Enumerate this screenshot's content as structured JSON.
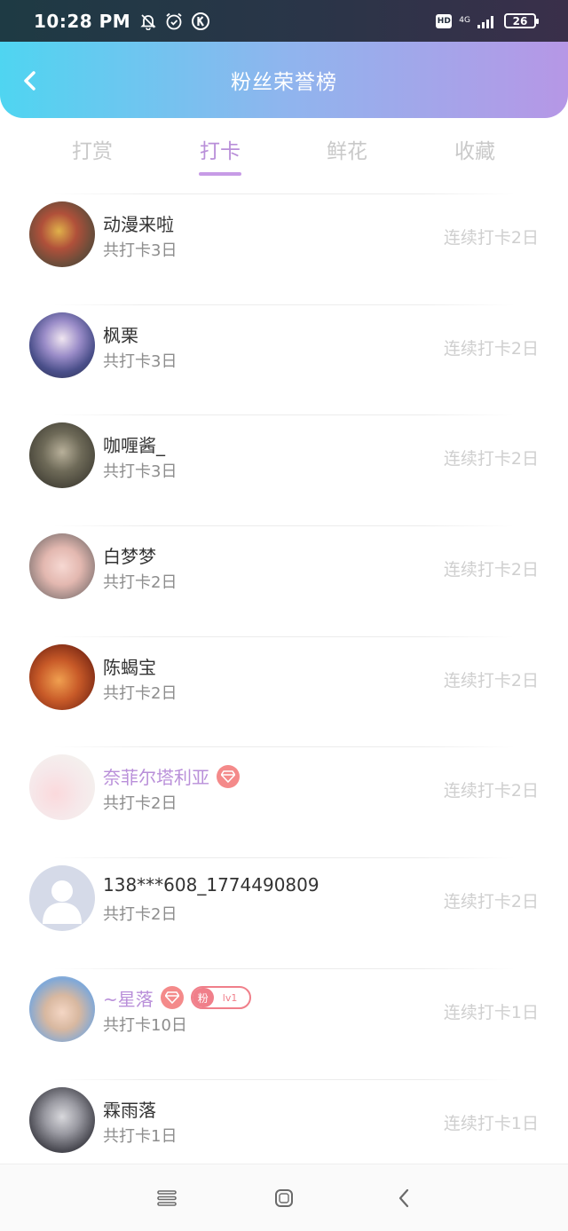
{
  "status_bar": {
    "time": "10:28 PM",
    "left_icons": [
      "bell-off-icon",
      "alarm-icon",
      "k-app-icon"
    ],
    "hd": "HD",
    "network": "4G",
    "battery": "26"
  },
  "header": {
    "title": "粉丝荣誉榜",
    "back_icon": "chevron-left-icon",
    "gradient": [
      "#4fd5f1",
      "#b697e6"
    ]
  },
  "tabs": [
    {
      "label": "打赏",
      "active": false
    },
    {
      "label": "打卡",
      "active": true
    },
    {
      "label": "鲜花",
      "active": false
    },
    {
      "label": "收藏",
      "active": false
    }
  ],
  "accent_color": "#b98fd9",
  "rows": [
    {
      "name": "动漫来啦",
      "total": "共打卡3日",
      "streak": "连续打卡2日"
    },
    {
      "name": "枫栗",
      "total": "共打卡3日",
      "streak": "连续打卡2日"
    },
    {
      "name": "咖喱酱_",
      "total": "共打卡3日",
      "streak": "连续打卡2日"
    },
    {
      "name": "白梦梦",
      "total": "共打卡2日",
      "streak": "连续打卡2日"
    },
    {
      "name": "陈蝎宝",
      "total": "共打卡2日",
      "streak": "连续打卡2日"
    },
    {
      "name": "奈菲尔塔利亚",
      "total": "共打卡2日",
      "streak": "连续打卡2日",
      "vip": true,
      "badges": [
        "gem-icon"
      ]
    },
    {
      "name": "138***608_1774490809",
      "total": "共打卡2日",
      "streak": "连续打卡2日"
    },
    {
      "name": "~星落",
      "total": "共打卡10日",
      "streak": "连续打卡1日",
      "vip": true,
      "badges": [
        "gem-icon"
      ],
      "fan_badge": {
        "label": "粉",
        "level": "lv1"
      }
    },
    {
      "name": "霖雨落",
      "total": "共打卡1日",
      "streak": "连续打卡1日"
    }
  ],
  "nav_bar": [
    "menu-icon",
    "home-square-icon",
    "back-chevron-icon"
  ]
}
